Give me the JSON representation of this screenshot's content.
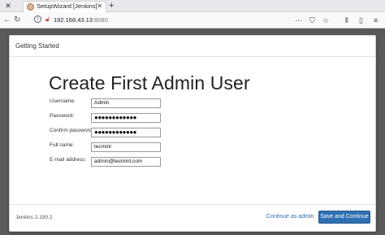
{
  "browser": {
    "tab_title": "SetupWizard [Jenkins]",
    "url_host": "192.168.43.13",
    "url_port": ":8080"
  },
  "dialog": {
    "header_title": "Getting Started",
    "heading": "Create First Admin User",
    "fields": [
      {
        "label": "Username:",
        "value": "Admin"
      },
      {
        "label": "Password:",
        "value": "●●●●●●●●●●●●"
      },
      {
        "label": "Confirm password:",
        "value": "●●●●●●●●●●●●"
      },
      {
        "label": "Full name:",
        "value": "tecmint"
      },
      {
        "label": "E-mail address:",
        "value": "admin@tecmint.com"
      }
    ],
    "version": "Jenkins 2.190.2",
    "continue_admin_label": "Continue as admin",
    "save_continue_label": "Save and Continue"
  }
}
